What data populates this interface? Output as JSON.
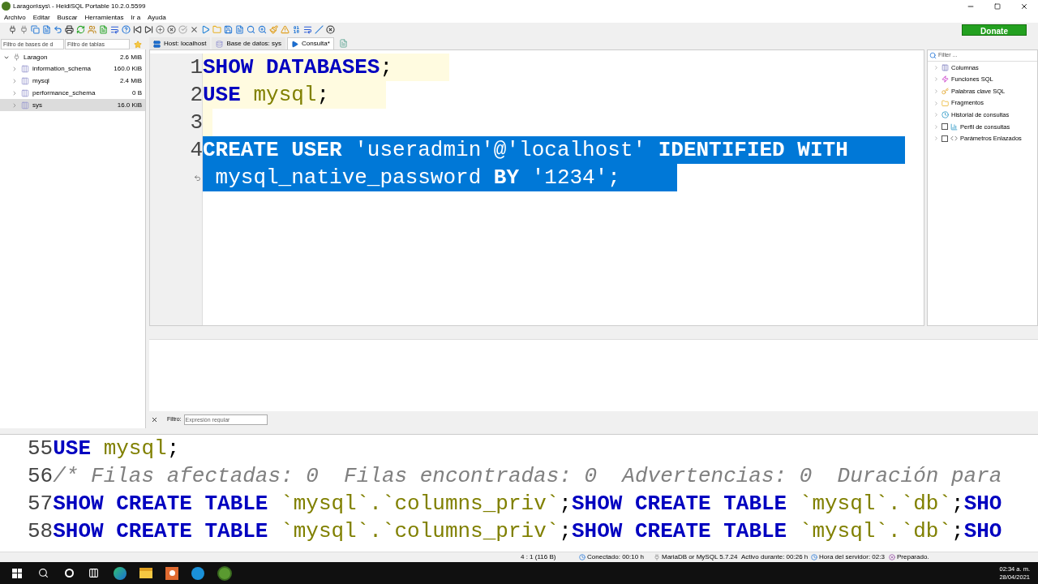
{
  "window": {
    "title": "Laragon\\sys\\ - HeidiSQL Portable 10.2.0.5599"
  },
  "menu": [
    "Archivo",
    "Editar",
    "Buscar",
    "Herramientas",
    "Ir a",
    "Ayuda"
  ],
  "donate": "Donate",
  "filters": [
    {
      "placeholder": "Filtro de bases de d"
    },
    {
      "placeholder": "Filtro de tablas"
    }
  ],
  "tabs": [
    {
      "label": "Host: localhost",
      "selected": false
    },
    {
      "label": "Base de datos: sys",
      "selected": false
    },
    {
      "label": "Consulta*",
      "selected": true
    }
  ],
  "tree": {
    "label": "Laragon",
    "size": "2.6 MiB",
    "expanded": true,
    "children": [
      {
        "label": "information_schema",
        "size": "160.0 KiB",
        "selected": false
      },
      {
        "label": "mysql",
        "size": "2.4 MiB",
        "selected": false
      },
      {
        "label": "performance_schema",
        "size": "0 B",
        "selected": false
      },
      {
        "label": "sys",
        "size": "16.0 KiB",
        "selected": true
      }
    ]
  },
  "editor": {
    "lines": [
      {
        "kind": "line",
        "number": "1",
        "selected": false,
        "tokens": [
          {
            "kind": "keyword",
            "text": "SHOW DATABASES"
          },
          {
            "kind": "plain",
            "text": ";"
          }
        ]
      },
      {
        "kind": "line",
        "number": "2",
        "selected": false,
        "tokens": [
          {
            "kind": "keyword",
            "text": "USE "
          },
          {
            "kind": "ident",
            "text": "mysql"
          },
          {
            "kind": "plain",
            "text": ";"
          }
        ]
      },
      {
        "kind": "line",
        "number": "3",
        "selected": false
      },
      {
        "kind": "line",
        "number": "4",
        "selected": true,
        "tokens": [
          {
            "kind": "keyword",
            "text": "CREATE USER "
          },
          {
            "kind": "ident",
            "text": "'useradmin'@'localhost'"
          },
          {
            "kind": "keyword",
            "text": " IDENTIFIED WITH"
          }
        ]
      },
      {
        "kind": "continuation",
        "selected": true,
        "tokens": [
          {
            "kind": "ident",
            "text": " mysql_native_password"
          },
          {
            "kind": "keyword",
            "text": " BY "
          },
          {
            "kind": "ident",
            "text": "'1234'"
          },
          {
            "kind": "plain",
            "text": ";"
          }
        ]
      }
    ]
  },
  "helpers": {
    "filter_placeholder": "Filter ...",
    "items": [
      {
        "kind": "folder",
        "label": "Columnas"
      },
      {
        "kind": "folder",
        "label": "Funciones SQL"
      },
      {
        "kind": "folder",
        "label": "Palabras clave SQL"
      },
      {
        "kind": "folder",
        "label": "Fragmentos"
      },
      {
        "kind": "folder",
        "label": "Historial de consultas"
      },
      {
        "kind": "checkbox",
        "label": "Perfil de consultas",
        "checked": false
      },
      {
        "kind": "checkbox",
        "label": "Parámetros Enlazados",
        "checked": false
      }
    ]
  },
  "log_filter": {
    "label": "Filtro:",
    "placeholder": "Expresión regular"
  },
  "log": [
    {
      "number": "55",
      "tokens": [
        {
          "kind": "keyword",
          "text": "USE "
        },
        {
          "kind": "ident",
          "text": "mysql"
        },
        {
          "kind": "plain",
          "text": ";"
        }
      ]
    },
    {
      "number": "56",
      "tokens": [
        {
          "kind": "comment",
          "text": "/* Filas afectadas: 0  Filas encontradas: 0  Advertencias: 0  Duración para"
        }
      ]
    },
    {
      "number": "57",
      "tokens": [
        {
          "kind": "keyword",
          "text": "SHOW CREATE TABLE "
        },
        {
          "kind": "ident",
          "text": "`mysql`.`columns_priv`"
        },
        {
          "kind": "plain",
          "text": ";"
        },
        {
          "kind": "keyword",
          "text": "SHOW CREATE TABLE "
        },
        {
          "kind": "ident",
          "text": "`mysql`.`db`"
        },
        {
          "kind": "plain",
          "text": ";"
        },
        {
          "kind": "keyword",
          "text": "SHO"
        }
      ]
    },
    {
      "number": "58",
      "tokens": [
        {
          "kind": "keyword",
          "text": "SHOW CREATE TABLE "
        },
        {
          "kind": "ident",
          "text": "`mysql`.`columns_priv`"
        },
        {
          "kind": "plain",
          "text": ";"
        },
        {
          "kind": "keyword",
          "text": "SHOW CREATE TABLE "
        },
        {
          "kind": "ident",
          "text": "`mysql`.`db`"
        },
        {
          "kind": "plain",
          "text": ";"
        },
        {
          "kind": "keyword",
          "text": "SHO"
        }
      ]
    }
  ],
  "status_bar": [
    "4 : 1 (116 B)",
    "Conectado: 00:10 h",
    "MariaDB or MySQL 5.7.24",
    "Activo durante: 00:26 h",
    "Hora del servidor: 02:3",
    "Preparado."
  ],
  "taskbar": {
    "time": "02:34 a. m.",
    "date": "28/04/2021"
  }
}
